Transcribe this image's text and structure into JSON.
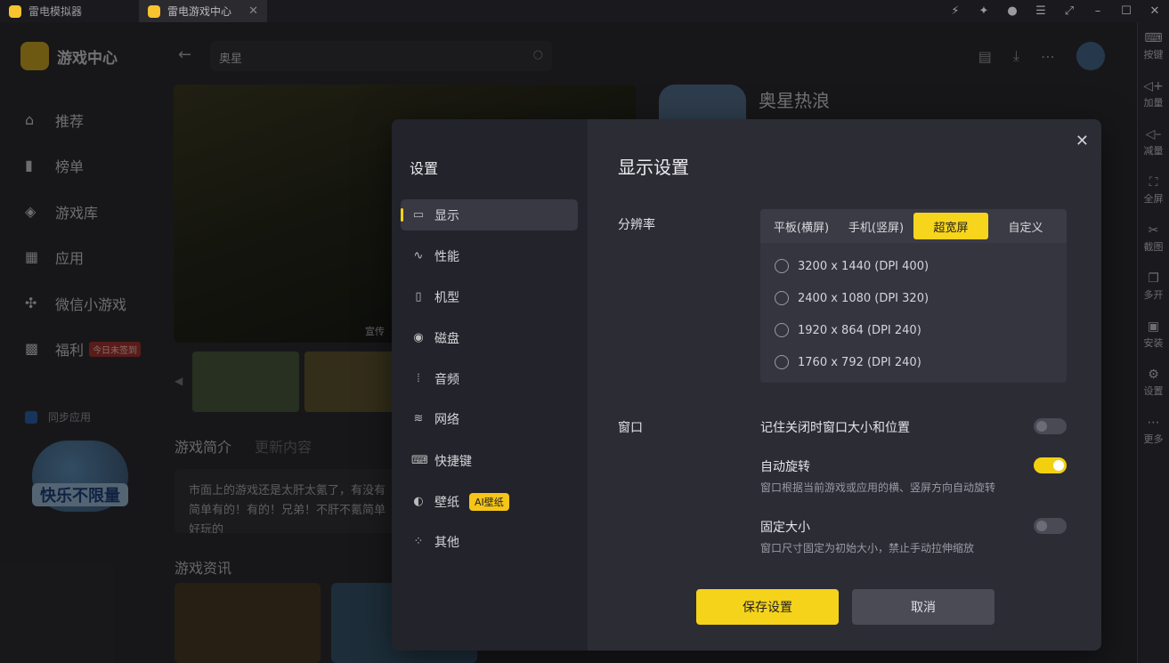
{
  "titlebar": {
    "tab1": "雷电模拟器",
    "tab2": "雷电游戏中心",
    "tab2_close": "✕"
  },
  "sidebar": {
    "brand": "游戏中心",
    "items": [
      {
        "label": "推荐",
        "icon": "home-icon"
      },
      {
        "label": "榜单",
        "icon": "chart-icon"
      },
      {
        "label": "游戏库",
        "icon": "gamepad-icon"
      },
      {
        "label": "应用",
        "icon": "apps-icon"
      },
      {
        "label": "微信小游戏",
        "icon": "wechat-icon"
      },
      {
        "label": "福利",
        "icon": "gift-icon"
      }
    ],
    "welfare_badge": "今日未签到",
    "sync": "同步应用",
    "promo_text": "快乐不限量"
  },
  "header": {
    "search_value": "奥星"
  },
  "content": {
    "game_title": "奥星热浪",
    "hero_tag": "宣传",
    "intro_tab": "游戏简介",
    "update_tab": "更新内容",
    "intro_text": "市面上的游戏还是太肝太氪了，有没有简单有的！有的！兄弟！不肝不氪简单好玩的",
    "news_title": "游戏资讯"
  },
  "right_toolbar": [
    "按键",
    "加量",
    "减量",
    "全屏",
    "截图",
    "多开",
    "安装",
    "设置",
    "更多"
  ],
  "dialog": {
    "nav_title": "设置",
    "nav": [
      {
        "label": "显示",
        "icon": "monitor-icon",
        "glyph": "▭"
      },
      {
        "label": "性能",
        "icon": "performance-icon",
        "glyph": "∿"
      },
      {
        "label": "机型",
        "icon": "phone-icon",
        "glyph": "▯"
      },
      {
        "label": "磁盘",
        "icon": "disk-icon",
        "glyph": "◉"
      },
      {
        "label": "音频",
        "icon": "audio-icon",
        "glyph": "⦙"
      },
      {
        "label": "网络",
        "icon": "wifi-icon",
        "glyph": "≋"
      },
      {
        "label": "快捷键",
        "icon": "keyboard-icon",
        "glyph": "⌨"
      },
      {
        "label": "壁纸",
        "icon": "palette-icon",
        "glyph": "◐"
      },
      {
        "label": "其他",
        "icon": "grid-icon",
        "glyph": "⁘"
      }
    ],
    "ai_badge": "AI壁纸",
    "title": "显示设置",
    "resolution_label": "分辨率",
    "segments": [
      "平板(横屏)",
      "手机(竖屏)",
      "超宽屏",
      "自定义"
    ],
    "selected_segment": "超宽屏",
    "resolutions": [
      "3200 x 1440  (DPI 400)",
      "2400 x 1080  (DPI 320)",
      "1920 x 864  (DPI 240)",
      "1760 x 792  (DPI 240)"
    ],
    "window_label": "窗口",
    "opt_remember": "记住关闭时窗口大小和位置",
    "opt_rotate": "自动旋转",
    "opt_rotate_desc": "窗口根据当前游戏或应用的横、竖屏方向自动旋转",
    "opt_fixed": "固定大小",
    "opt_fixed_desc": "窗口尺寸固定为初始大小，禁止手动拉伸缩放",
    "toggles": {
      "remember": false,
      "rotate": true,
      "fixed": false
    },
    "save": "保存设置",
    "cancel": "取消"
  },
  "colors": {
    "accent": "#f5d31b",
    "dialog_bg": "#2c2c35",
    "nav_bg": "#23232b"
  }
}
